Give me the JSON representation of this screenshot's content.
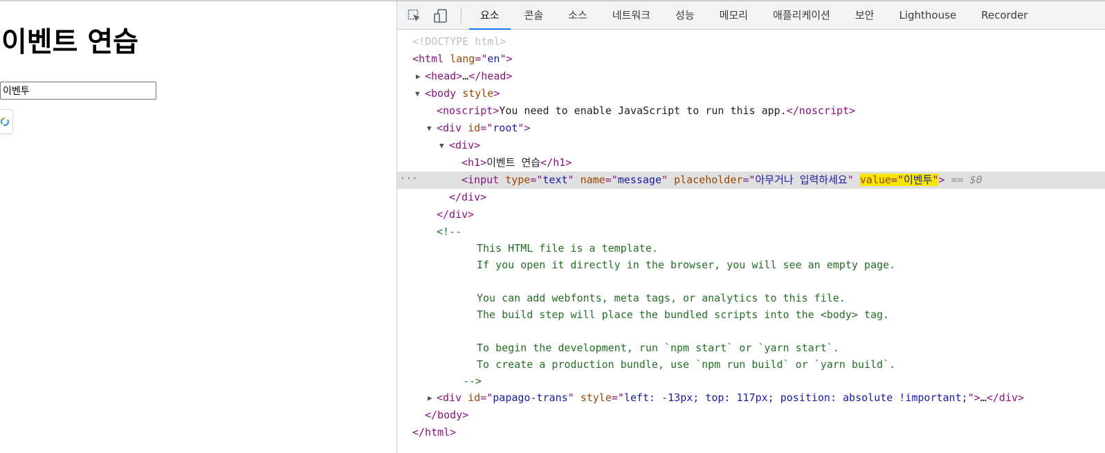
{
  "page": {
    "heading": "이벤트 연습",
    "input_value": "이벤투",
    "input_placeholder": "아무거나 입력하세요"
  },
  "devtools": {
    "tabs": [
      "요소",
      "콘솔",
      "소스",
      "네트워크",
      "성능",
      "메모리",
      "애플리케이션",
      "보안",
      "Lighthouse",
      "Recorder"
    ],
    "active_tab": "요소",
    "tree": {
      "doctype": "<!DOCTYPE html>",
      "html_lang": "en",
      "noscript_text": "You need to enable JavaScript to run this app.",
      "root_id": "root",
      "h1_text": "이벤트 연습",
      "input_type": "text",
      "input_name": "message",
      "input_placeholder": "아무거나 입력하세요",
      "input_value": "이벤투",
      "selected_marker": "== $0",
      "comment_open": "<!--",
      "comment_lines": [
        "This HTML file is a template.",
        "If you open it directly in the browser, you will see an empty page.",
        "",
        "You can add webfonts, meta tags, or analytics to this file.",
        "The build step will place the bundled scripts into the <body> tag.",
        "",
        "To begin the development, run `npm start` or `yarn start`.",
        "To create a production bundle, use `npm run build` or `yarn build`."
      ],
      "comment_close": "-->",
      "papago_id": "papago-trans",
      "papago_style": "left: -13px; top: 117px; position: absolute !important;"
    }
  },
  "icons": {
    "inspect": "inspect-element-icon",
    "device": "device-toolbar-icon",
    "papago": "papago-translate-icon"
  }
}
